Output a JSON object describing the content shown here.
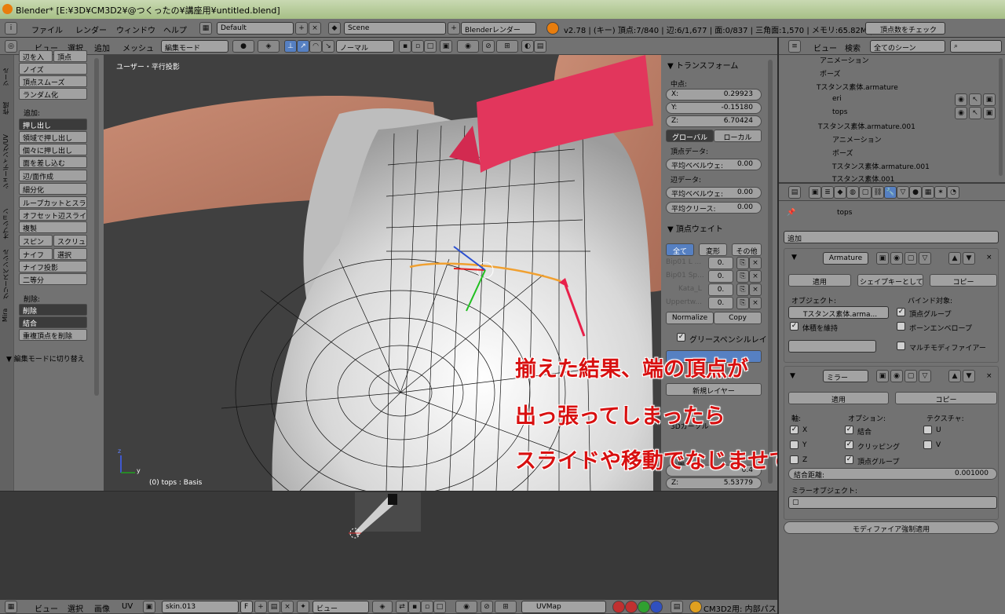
{
  "titlebar": {
    "text": "Blender* [E:¥3D¥CM3D2¥@つくったの¥講座用¥untitled.blend]"
  },
  "infobar": {
    "menus": [
      "ファイル",
      "レンダー",
      "ウィンドウ",
      "ヘルプ"
    ],
    "layout": "Default",
    "scene": "Scene",
    "engine": "Blenderレンダー",
    "stats": "v2.78 | (キー) 頂点:7/840 | 辺:6/1,677 | 面:0/837 | 三角面:1,570 | メモリ:65.82M | tops",
    "check_button": "頂点数をチェック"
  },
  "view3d_header": {
    "menus": [
      "ビュー",
      "選択",
      "追加",
      "メッシュ"
    ],
    "mode": "編集モード",
    "orientation": "ノーマル"
  },
  "tool_tabs": [
    "ツール",
    "作成",
    "シェーディング/UV",
    "オプション",
    "グリースペンシル",
    "Mira"
  ],
  "tool_panel": {
    "top_items": [
      "辺を入",
      "頂点"
    ],
    "items1": [
      "ノイズ",
      "頂点スムーズ",
      "ランダム化"
    ],
    "add_label": "追加:",
    "extrude": "押し出し",
    "items2": [
      "領域で押し出し",
      "個々に押し出し",
      "面を差し込む",
      "辺/面作成",
      "細分化",
      "ループカットとスライド",
      "オフセット辺スライド",
      "複製"
    ],
    "spin": "スピン",
    "screw": "スクリュー",
    "knife": "ナイフ",
    "select": "選択",
    "knife_project": "ナイフ投影",
    "bisect": "二等分",
    "delete_label": "削除:",
    "delete": "削除",
    "merge": "結合",
    "remove_doubles": "重複頂点を削除",
    "last_op": "▼ 編集モードに切り替え"
  },
  "viewport": {
    "view_label": "ユーザー・平行投影",
    "object_label": "(0) tops : Basis",
    "axis_y": "y",
    "axis_z": "z"
  },
  "annotation": {
    "line1": "揃えた結果、端の頂点が",
    "line2": "出っ張ってしまったら",
    "line3": "スライドや移動でなじませておく"
  },
  "n_panel": {
    "transform_title": "▼ トランスフォーム",
    "median_label": "中点:",
    "x_label": "X:",
    "x": "0.29923",
    "y_label": "Y:",
    "y": "-0.15180",
    "z_label": "Z:",
    "z": "6.70424",
    "global": "グローバル",
    "local": "ローカル",
    "vertex_data": "頂点データ:",
    "bevel_weight": "平均ベベルウェ:",
    "bevel_weight_val": "0.00",
    "edge_data": "辺データ:",
    "edge_bevel": "平均ベベルウェ:",
    "edge_bevel_val": "0.00",
    "crease": "平均クリース:",
    "crease_val": "0.00",
    "vw_title": "▼ 頂点ウェイト",
    "vw_tabs": [
      "全て",
      "変形",
      "その他"
    ],
    "weights": [
      {
        "name": "Bip01 L ...",
        "val": "0."
      },
      {
        "name": "Bip01 Sp...",
        "val": "0."
      },
      {
        "name": "Kata_L",
        "val": "0."
      },
      {
        "name": "Uppertw...",
        "val": "0."
      }
    ],
    "normalize": "Normalize",
    "copy": "Copy",
    "gp_title": "グリースペンシルレイ",
    "new_layer": "新規レイヤー",
    "pos_label": "位置",
    "pos_y": "0.4",
    "pos_z_label": "Z:",
    "pos_z": "5.53779",
    "partial_label": "3Dカーソル"
  },
  "outliner": {
    "view": "ビュー",
    "search": "検索",
    "scenes": "全てのシーン",
    "rows": [
      {
        "indent": 40,
        "text": "アニメーション"
      },
      {
        "indent": 40,
        "text": "ポーズ"
      },
      {
        "indent": 30,
        "text": "Tスタンス素体.armature"
      },
      {
        "indent": 40,
        "text": "eri"
      },
      {
        "indent": 40,
        "text": "tops"
      },
      {
        "indent": 20,
        "text": "Tスタンス素体.armature.001"
      },
      {
        "indent": 40,
        "text": "アニメーション"
      },
      {
        "indent": 40,
        "text": "ポーズ"
      },
      {
        "indent": 40,
        "text": "Tスタンス素体.armature.001"
      },
      {
        "indent": 40,
        "text": "Tスタンス素体.001"
      }
    ]
  },
  "properties": {
    "breadcrumb": "tops",
    "add_modifier": "追加",
    "armature": {
      "name": "Armature",
      "apply": "適用",
      "shapekey": "シェイプキーとして適用",
      "copy": "コピー",
      "object_label": "オブジェクト:",
      "object": "Tスタンス素体.arma...",
      "preserve_volume": "体積を維持",
      "bind_label": "バインド対象:",
      "vertex_groups": "頂点グループ",
      "bone_envelopes": "ボーンエンベロープ",
      "multi_modifier": "マルチモディファイアー"
    },
    "mirror": {
      "name": "ミラー",
      "apply": "適用",
      "copy": "コピー",
      "axis_label": "軸:",
      "options_label": "オプション:",
      "texture_label": "テクスチャ:",
      "x": "X",
      "y": "Y",
      "z": "Z",
      "merge": "結合",
      "clipping": "クリッピング",
      "vgroup": "頂点グループ",
      "u": "U",
      "v": "V",
      "merge_distance": "結合距離:",
      "merge_distance_val": "0.001000",
      "mirror_object": "ミラーオブジェクト:"
    },
    "force_apply": "モディファイア強制適用"
  },
  "bottom_header": {
    "menus": [
      "ビュー",
      "選択",
      "画像",
      "UV"
    ],
    "image": "skin.013",
    "f": "F",
    "view": "ビュー",
    "uvmap": "UVMap",
    "cm3d2": "CM3D2用: 内部パス"
  },
  "colors": {
    "accent": "#5680c2",
    "annotation": "#d81010",
    "shirt": "#e2365c"
  }
}
